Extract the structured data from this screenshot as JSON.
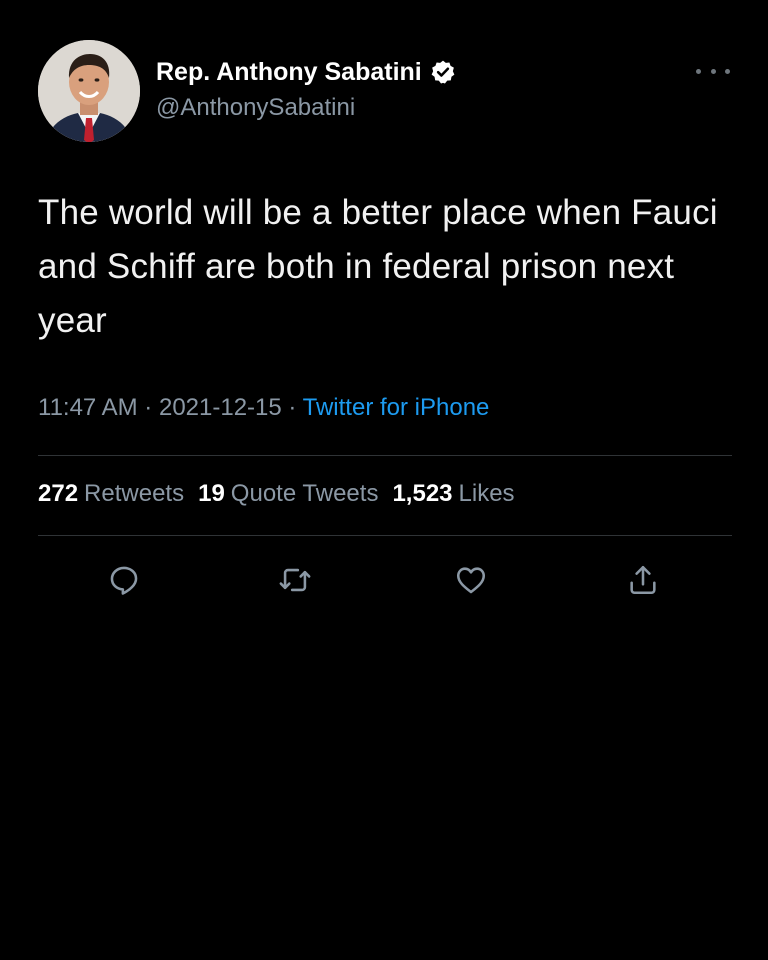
{
  "author": {
    "display_name": "Rep. Anthony Sabatini",
    "handle": "@AnthonySabatini",
    "verified": true,
    "avatar_icon": "profile-photo"
  },
  "tweet": {
    "text": "The world will be a better place when Fauci and Schiff are both in federal prison next year",
    "time": "11:47 AM",
    "separator": "·",
    "date": "2021-12-15",
    "source": "Twitter for iPhone"
  },
  "stats": {
    "retweets_count": "272",
    "retweets_label": "Retweets",
    "quotes_count": "19",
    "quotes_label": "Quote Tweets",
    "likes_count": "1,523",
    "likes_label": "Likes"
  },
  "icons": {
    "more": "more-options-icon",
    "reply": "reply-icon",
    "retweet": "retweet-icon",
    "like": "heart-icon",
    "share": "share-icon",
    "verified": "verified-badge-icon"
  },
  "colors": {
    "background": "#000000",
    "text_primary": "#ffffff",
    "text_secondary": "#8b98a5",
    "accent": "#1d9bf0",
    "divider": "#2f3336"
  }
}
